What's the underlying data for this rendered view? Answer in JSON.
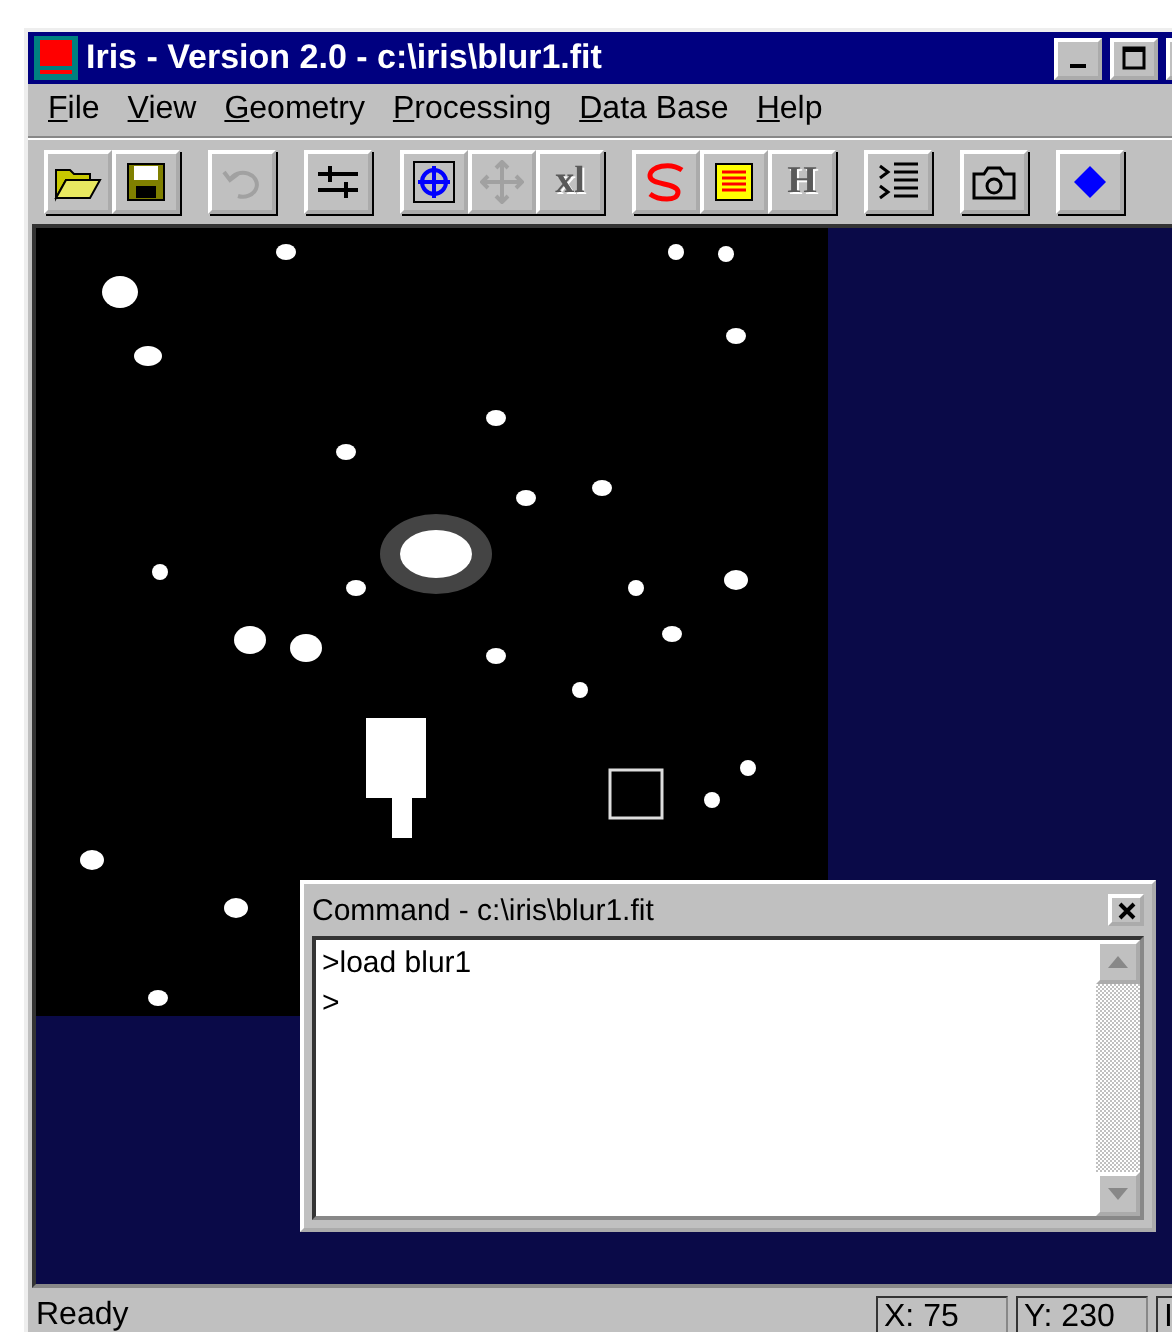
{
  "window": {
    "title": "Iris - Version 2.0 - c:\\iris\\blur1.fit"
  },
  "menu": [
    "File",
    "View",
    "Geometry",
    "Processing",
    "Data Base",
    "Help"
  ],
  "toolbar": [
    [
      {
        "kind": "open",
        "disabled": false
      },
      {
        "kind": "save",
        "disabled": false
      }
    ],
    [
      {
        "kind": "undo",
        "disabled": true
      }
    ],
    [
      {
        "kind": "sliders",
        "disabled": false
      }
    ],
    [
      {
        "kind": "target",
        "disabled": false
      },
      {
        "kind": "move",
        "disabled": true
      },
      {
        "kind": "text",
        "label": "xl",
        "disabled": true
      }
    ],
    [
      {
        "kind": "swirl",
        "disabled": false
      },
      {
        "kind": "lines",
        "disabled": false
      },
      {
        "kind": "text",
        "label": "H",
        "disabled": true
      }
    ],
    [
      {
        "kind": "list",
        "disabled": false
      }
    ],
    [
      {
        "kind": "camera",
        "disabled": false
      }
    ],
    [
      {
        "kind": "diamond",
        "disabled": false
      }
    ]
  ],
  "command": {
    "title": "Command - c:\\iris\\blur1.fit",
    "lines": [
      ">load blur1",
      ">"
    ]
  },
  "status_bar": {
    "message": "Ready",
    "fields": [
      "X: 75",
      "Y: 230",
      "I"
    ]
  }
}
